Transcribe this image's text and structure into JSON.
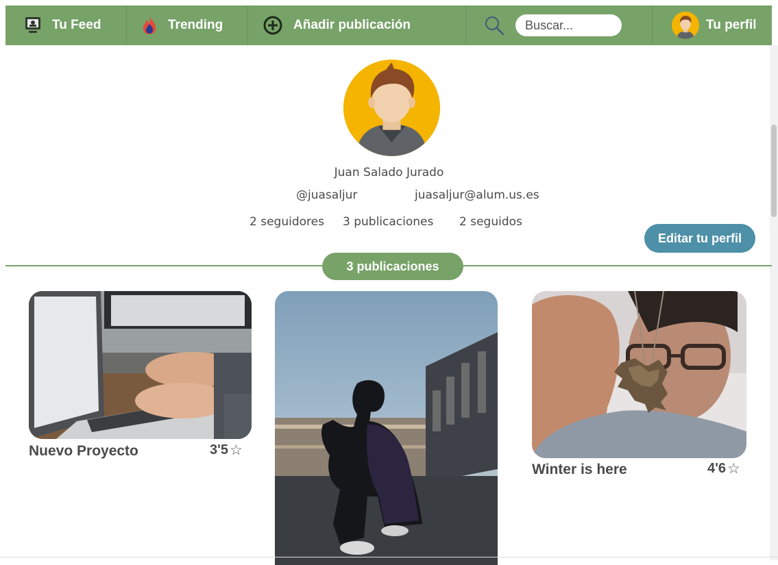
{
  "nav": {
    "feed_label": "Tu Feed",
    "trending_label": "Trending",
    "add_label": "Añadir publicación",
    "search_placeholder": "Buscar...",
    "profile_label": "Tu perfil"
  },
  "profile": {
    "full_name": "Juan Salado Jurado",
    "username": "@juasaljur",
    "email": "juasaljur@alum.us.es",
    "followers": "2 seguidores",
    "posts": "3 publicaciones",
    "following": "2 seguidos",
    "edit_label": "Editar tu perfil"
  },
  "section": {
    "label": "3 publicaciones"
  },
  "posts": [
    {
      "title": "Nuevo Proyecto",
      "rating": "3'5"
    },
    {
      "title": "",
      "rating": ""
    },
    {
      "title": "Winter is here",
      "rating": "4'6"
    }
  ],
  "icons": {
    "feed": "monitor-icon",
    "trending": "fire-icon",
    "add": "plus-circle-icon",
    "search": "search-icon",
    "star": "star-outline-icon"
  },
  "colors": {
    "nav_bg": "#77a268",
    "edit_button": "#4d90a8",
    "avatar_bg": "#f4b400"
  }
}
